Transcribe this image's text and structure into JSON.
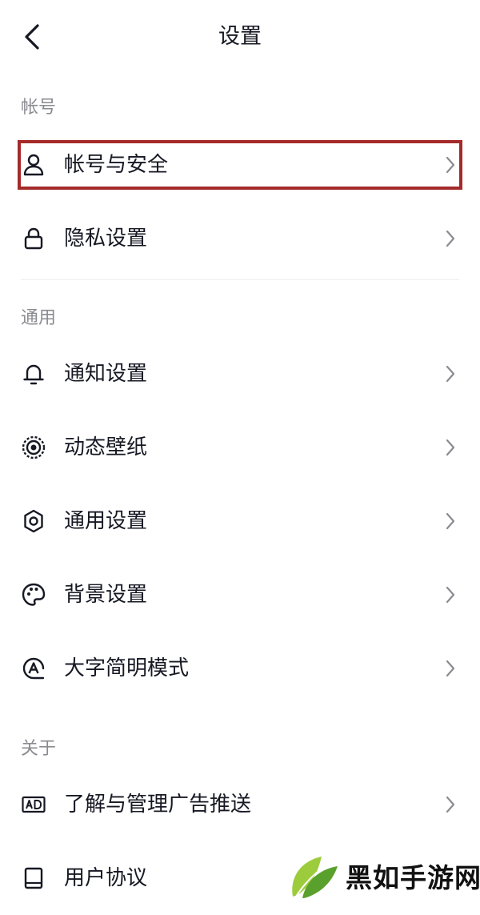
{
  "header": {
    "title": "设置",
    "back_icon": "chevron-left-icon"
  },
  "sections": [
    {
      "label": "帐号",
      "items": [
        {
          "label": "帐号与安全",
          "icon": "user-icon",
          "highlighted": true
        },
        {
          "label": "隐私设置",
          "icon": "lock-icon"
        }
      ]
    },
    {
      "label": "通用",
      "items": [
        {
          "label": "通知设置",
          "icon": "bell-icon"
        },
        {
          "label": "动态壁纸",
          "icon": "target-icon"
        },
        {
          "label": "通用设置",
          "icon": "gear-icon"
        },
        {
          "label": "背景设置",
          "icon": "palette-icon"
        },
        {
          "label": "大字简明模式",
          "icon": "font-a-icon"
        }
      ]
    },
    {
      "label": "关于",
      "items": [
        {
          "label": "了解与管理广告推送",
          "icon": "ad-icon"
        },
        {
          "label": "用户协议",
          "icon": "book-icon"
        }
      ]
    }
  ],
  "highlight_color": "#a52a2a",
  "watermark": {
    "text": "黑如手游网"
  }
}
